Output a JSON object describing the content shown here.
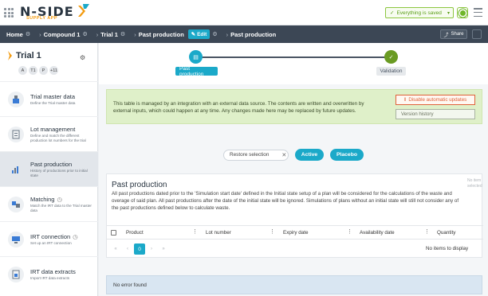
{
  "app": {
    "logo_text": "N-SIDE",
    "logo_subtitle": "SUPPLY APP",
    "save_status": "Everything is saved"
  },
  "breadcrumb": {
    "items": [
      "Home",
      "Compound 1",
      "Trial 1",
      "Past production",
      "Past production"
    ],
    "edit_label": "Edit",
    "share_label": "Share"
  },
  "sidebar": {
    "trial_title": "Trial 1",
    "avatars": [
      "A",
      "T1",
      "P",
      "+11"
    ],
    "items": [
      {
        "title": "Trial master data",
        "desc": "Define the Trial master data"
      },
      {
        "title": "Lot management",
        "desc": "Define and match the different production lot numbers for the trial"
      },
      {
        "title": "Past production",
        "desc": "History of productions prior to initial state"
      },
      {
        "title": "Matching",
        "desc": "Match the IRT data to the Trial master data"
      },
      {
        "title": "IRT connection",
        "desc": "Set up an IRT connection"
      },
      {
        "title": "IRT data extracts",
        "desc": "Import IRT data extracts"
      }
    ]
  },
  "stepper": {
    "steps": [
      "Past production",
      "Validation"
    ]
  },
  "notice": {
    "text": "This table is managed by an integration with an external data source. The contents are written and overwritten by external inputs, which could happen at any time. Any changes made here may be replaced by future updates.",
    "disable_label": "Disable automatic updates",
    "version_label": "Version history"
  },
  "filters": {
    "restore_label": "Restore selection",
    "active_label": "Active",
    "placebo_label": "Placebo"
  },
  "panel": {
    "title": "Past production",
    "side_text": "No item selected",
    "description": "All past productions dated prior to the 'Simulation start date' defined in the Initial state setup of a plan will be considered for the calculations of the waste and overage of said plan. All past productions after the date of the initial state will be ignored. Simulations of plans without an initial state will still not consider any of the past productions defined below to calculate waste.",
    "columns": [
      "Product",
      "Lot number",
      "Expiry date",
      "Availability date",
      "Quantity"
    ],
    "current_page": "0",
    "empty_text": "No items to display"
  },
  "error_text": "No error found",
  "colors": {
    "accent": "#1ba9c9",
    "brand_orange": "#f39c12",
    "success": "#6fb62b",
    "danger": "#e0613a",
    "header_bg": "#3c4755"
  }
}
